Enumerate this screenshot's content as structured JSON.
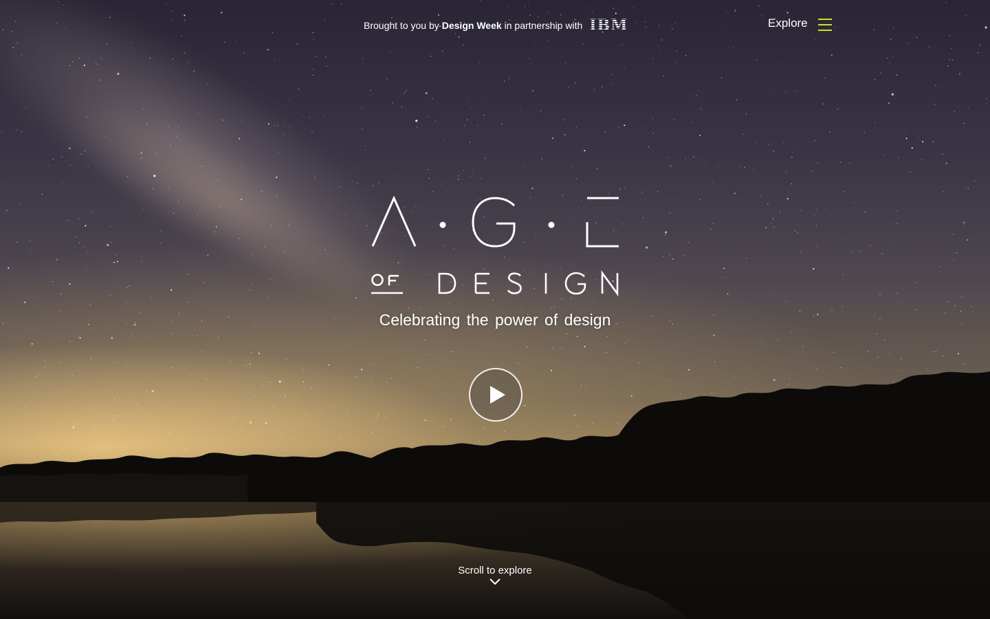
{
  "header": {
    "sponsor_prefix": "Brought to you by",
    "sponsor_name": "Design Week",
    "sponsor_mid": "in partnership with",
    "partner_logo": "IBM",
    "explore_label": "Explore",
    "menu_icon": "hamburger-icon",
    "menu_color": "#c8e61e"
  },
  "hero": {
    "logo_letters": [
      "A",
      "G",
      "E"
    ],
    "logo_of": "OF",
    "logo_design": "DESIGN",
    "tagline": "Celebrating the power of design",
    "play_icon": "play-icon",
    "scroll_label": "Scroll to explore",
    "scroll_icon": "chevron-down-icon"
  }
}
